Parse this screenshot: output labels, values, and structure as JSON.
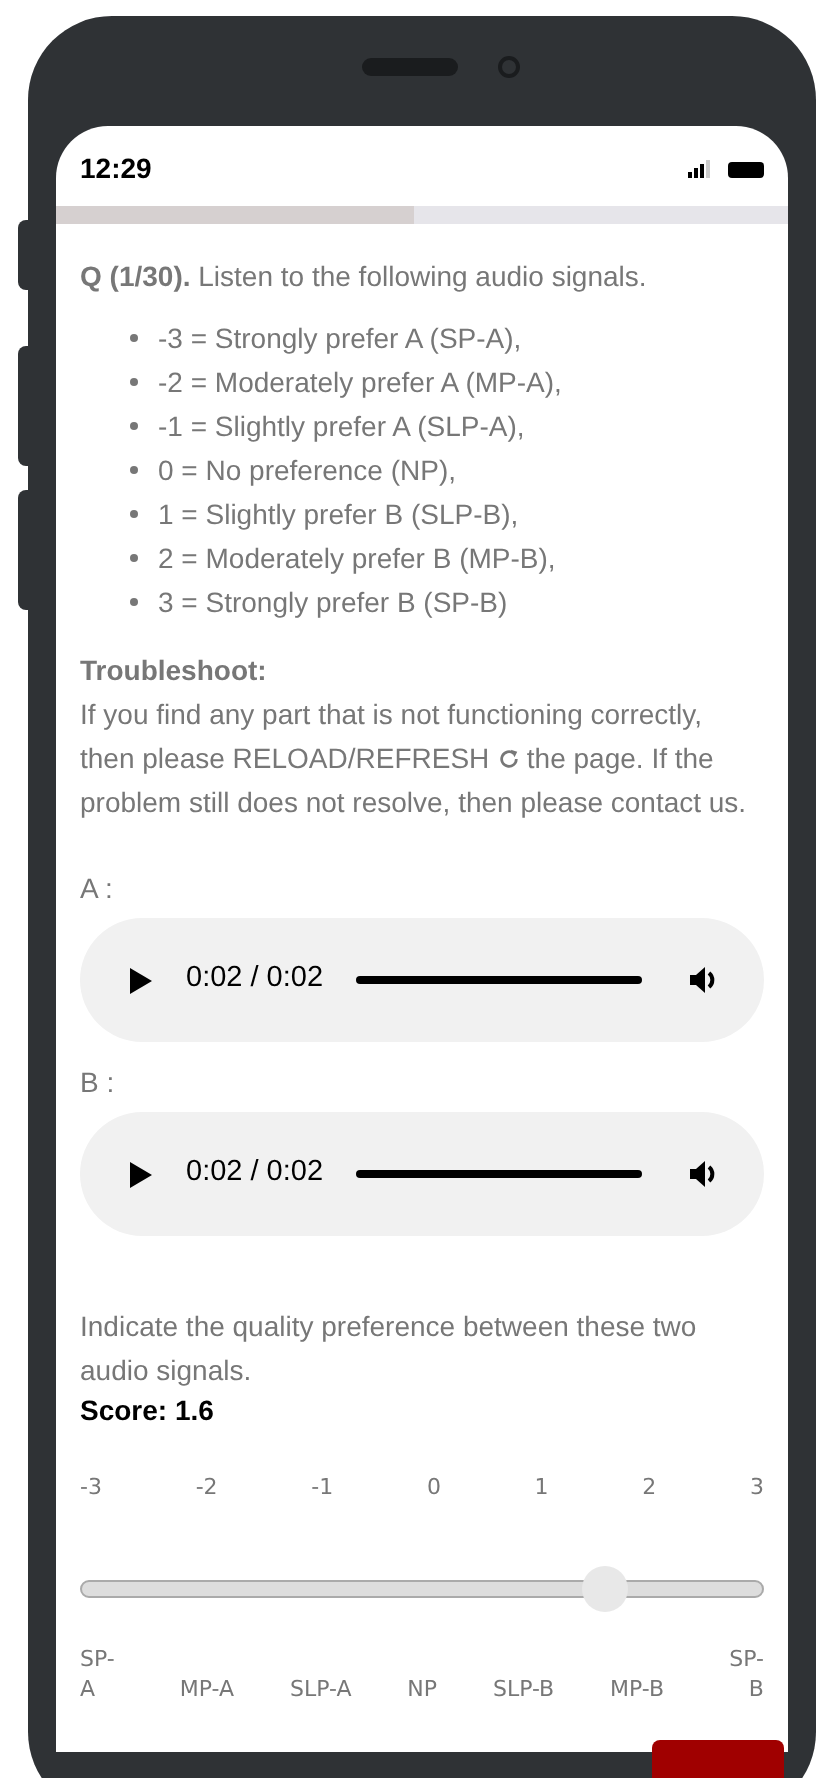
{
  "status_bar": {
    "time": "12:29"
  },
  "progress": {
    "level": 0.49
  },
  "question": {
    "number": "Q (1/30).",
    "text": "Listen to the following audio signals."
  },
  "scale_legend": [
    "-3 = Strongly prefer A (SP-A),",
    "-2 = Moderately prefer A (MP-A),",
    "-1 = Slightly prefer A (SLP-A),",
    "0 = No preference (NP),",
    "1 = Slightly prefer B (SLP-B),",
    "2 = Moderately prefer B (MP-B),",
    "3 = Strongly prefer B (SP-B)"
  ],
  "troubleshoot": {
    "title": "Troubleshoot:",
    "text_before": "If you find any part that is not functioning correctly, then please RELOAD/REFRESH",
    "text_after": "the page. If the problem still does not resolve, then please contact us."
  },
  "players": [
    {
      "label": "A :",
      "time": "0:02 / 0:02"
    },
    {
      "label": "B :",
      "time": "0:02 / 0:02"
    }
  ],
  "prompt": "Indicate the quality preference between these two audio signals.",
  "score": "Score: 1.6",
  "slider": {
    "level": 0.767,
    "ticks": [
      "-3",
      "-2",
      "-1",
      "0",
      "1",
      "2",
      "3"
    ],
    "labels": [
      "SP-A",
      "MP-A",
      "SLP-A",
      "NP",
      "SLP-B",
      "MP-B",
      "SP-B"
    ]
  }
}
